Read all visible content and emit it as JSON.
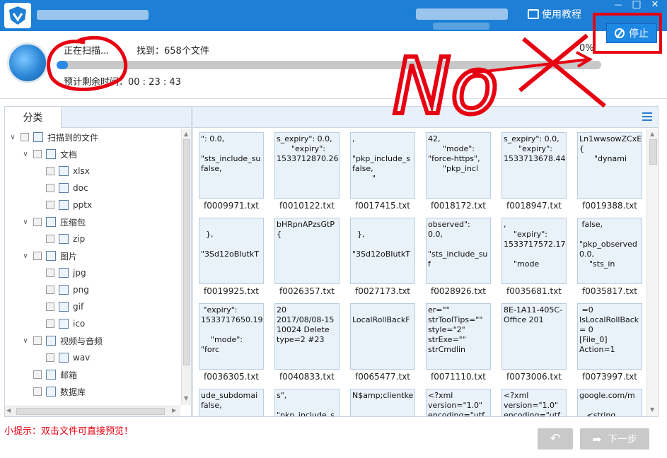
{
  "header": {
    "tutorial_label": "使用教程",
    "minimize_label": "—",
    "restore_label": "□",
    "close_label": "✕"
  },
  "scan": {
    "status": "正在扫描...",
    "found": "找到：658个文件",
    "percent": "0%",
    "progress_fraction": 0.01,
    "remaining": "预计剩余时间：00 : 23 : 43",
    "stop_label": "停止"
  },
  "annotation": {
    "text": "No",
    "color": "#e60012"
  },
  "sidebar": {
    "tab_label": "分类",
    "tree": [
      {
        "label": "扫描到的文件",
        "level": 0,
        "icon": "list-icon"
      },
      {
        "label": "文档",
        "level": 1,
        "icon": "document-icon"
      },
      {
        "label": "xlsx",
        "level": 2,
        "icon": "xlsx-icon"
      },
      {
        "label": "doc",
        "level": 2,
        "icon": "doc-icon"
      },
      {
        "label": "pptx",
        "level": 2,
        "icon": "pptx-icon"
      },
      {
        "label": "压缩包",
        "level": 1,
        "icon": "archive-icon"
      },
      {
        "label": "zip",
        "level": 2,
        "icon": "zip-icon"
      },
      {
        "label": "图片",
        "level": 1,
        "icon": "image-icon"
      },
      {
        "label": "jpg",
        "level": 2,
        "icon": "jpg-icon"
      },
      {
        "label": "png",
        "level": 2,
        "icon": "png-icon"
      },
      {
        "label": "gif",
        "level": 2,
        "icon": "gif-icon"
      },
      {
        "label": "ico",
        "level": 2,
        "icon": "ico-icon"
      },
      {
        "label": "视频与音频",
        "level": 1,
        "icon": "video-icon"
      },
      {
        "label": "wav",
        "level": 2,
        "icon": "wav-icon"
      },
      {
        "label": "邮箱",
        "level": 1,
        "icon": "mail-icon"
      },
      {
        "label": "数据库",
        "level": 1,
        "icon": "database-icon"
      }
    ]
  },
  "files": [
    {
      "name": "f0009971.txt",
      "preview": "\": 0.0,\n\n\"sts_include_su\nfalse,"
    },
    {
      "name": "f0010122.txt",
      "preview": "s_expiry\": 0.0,\n      \"expiry\":\n1533712870.26"
    },
    {
      "name": "f0017415.txt",
      "preview": ",\n\n\"pkp_include_s\nfalse,\n        \""
    },
    {
      "name": "f0018172.txt",
      "preview": "42,\n      \"mode\":\n\"force-https\",\n      \"pkp_incl"
    },
    {
      "name": "f0018947.txt",
      "preview": "s_expiry\": 0.0,\n      \"expiry\":\n1533713678.44"
    },
    {
      "name": "f0019388.txt",
      "preview": "Ln1wwsowZCxE\n{\n      \"dynami"
    },
    {
      "name": "f0019925.txt",
      "preview": "\n  },\n\n\"3Sd12oBIutkT"
    },
    {
      "name": "f0026357.txt",
      "preview": "bHRpnAPzsGtP\n{"
    },
    {
      "name": "f0027173.txt",
      "preview": "\n  },\n\n\"3Sd12oBIutkT"
    },
    {
      "name": "f0028926.txt",
      "preview": "observed\":\n0.0,\n\n\"sts_include_su\nf"
    },
    {
      "name": "f0035681.txt",
      "preview": ",\n    \"expiry\":\n1533717572.17\n\n    \"mode"
    },
    {
      "name": "f0035817.txt",
      "preview": " false,\n\n\"pkp_observed\n0.0,\n    \"sts_in"
    },
    {
      "name": "f0036305.txt",
      "preview": " \"expiry\":\n1533717650.19\n\n    \"mode\":\n\"forc"
    },
    {
      "name": "f0040833.txt",
      "preview": "20\n2017/08/08-15\n10024 Delete\ntype=2 #23"
    },
    {
      "name": "f0065477.txt",
      "preview": "\nLocalRollBackF"
    },
    {
      "name": "f0071110.txt",
      "preview": "er=\"\"\nstrToolTips=\"\"\nstyle=\"2\"\nstrExe=\"\"\nstrCmdlin"
    },
    {
      "name": "f0073006.txt",
      "preview": "8E-1A11-405C-\nOffice 201"
    },
    {
      "name": "f0073997.txt",
      "preview": " =0\nIsLocalRollBack\n= 0\n[File_0]\nAction=1"
    },
    {
      "name": "",
      "preview": "ude_subdomai\nfalse,"
    },
    {
      "name": "",
      "preview": "s\",\n\n\"pkp_include_s"
    },
    {
      "name": "",
      "preview": "N$amp;clientke"
    },
    {
      "name": "",
      "preview": "<?xml\nversion=\"1.0\"\nencoding=\"utf"
    },
    {
      "name": "",
      "preview": "<?xml\nversion=\"1.0\"\nencoding=\"utf"
    },
    {
      "name": "",
      "preview": "google.com/m\n\n   <string"
    }
  ],
  "footer": {
    "tip": "小提示：双击文件可直接预览！",
    "back_label": "↶",
    "next_label": "下一步"
  }
}
